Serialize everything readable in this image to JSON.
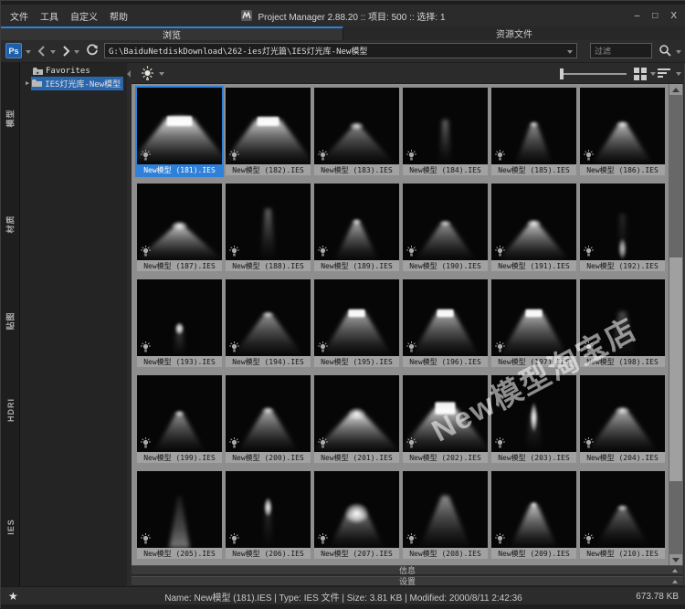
{
  "window": {
    "title": "Project Manager 2.88.20  ::  项目: 500  ::  选择: 1",
    "minimize": "–",
    "maximize": "□",
    "close": "X"
  },
  "menu": {
    "items": [
      "文件",
      "工具",
      "自定义",
      "帮助"
    ]
  },
  "tabs": [
    {
      "label": "浏览",
      "active": true
    },
    {
      "label": "资源文件",
      "active": false
    }
  ],
  "toolbar": {
    "ps_label": "Ps",
    "path": "G:\\BaiduNetdiskDownload\\262-ies灯光篇\\IES灯光库-New模型",
    "filter_placeholder": "过滤"
  },
  "sidebar": {
    "tabs": [
      "模型",
      "材质",
      "贴图",
      "HDRI",
      "IES"
    ],
    "active": "IES"
  },
  "tree": {
    "items": [
      {
        "label": "Favorites",
        "selected": false,
        "expandable": false
      },
      {
        "label": "IES灯光库-New模型",
        "selected": true,
        "expandable": true
      }
    ]
  },
  "watermark": {
    "text": "New模型淘宝店"
  },
  "panels": [
    {
      "label": "信息"
    },
    {
      "label": "设置"
    }
  ],
  "statusbar": {
    "info": "Name: New模型 (181).IES | Type: IES 文件 | Size: 3.81 KB | Modified: 2000/8/11 2:42:36",
    "total": "673.78 KB"
  },
  "grid": {
    "items": [
      {
        "label": "New模型 (181).IES",
        "selected": true,
        "light": {
          "cone": {
            "a": 0.42,
            "tw": 0.17,
            "bw": 0.6,
            "i": 0.85
          },
          "fix": {
            "y": 0.37,
            "h": 0.13,
            "w": 0.15,
            "i": 0.95
          },
          "apex": {
            "i": 0.5,
            "w": 0.45,
            "h": 0.18
          }
        }
      },
      {
        "label": "New模型 (182).IES",
        "light": {
          "cone": {
            "a": 0.42,
            "tw": 0.15,
            "bw": 0.55,
            "i": 0.8
          },
          "fix": {
            "y": 0.38,
            "h": 0.12,
            "w": 0.13,
            "i": 0.95
          }
        }
      },
      {
        "label": "New模型 (183).IES",
        "light": {
          "cone": {
            "a": 0.5,
            "tw": 0.04,
            "bw": 0.46,
            "i": 0.5
          },
          "apex": {
            "i": 0.85,
            "w": 0.18,
            "h": 0.12
          }
        }
      },
      {
        "label": "New模型 (184).IES",
        "light": {
          "cone": {
            "a": 0.42,
            "tw": 0.035,
            "bw": 0.07,
            "i": 0.38
          }
        }
      },
      {
        "label": "New模型 (185).IES",
        "light": {
          "cone": {
            "a": 0.48,
            "tw": 0.035,
            "bw": 0.22,
            "i": 0.55
          },
          "apex": {
            "i": 0.8,
            "w": 0.12,
            "h": 0.1
          }
        }
      },
      {
        "label": "New模型 (186).IES",
        "light": {
          "cone": {
            "a": 0.48,
            "tw": 0.05,
            "bw": 0.36,
            "i": 0.7
          },
          "apex": {
            "i": 0.9,
            "w": 0.16,
            "h": 0.11
          }
        }
      },
      {
        "label": "New模型 (187).IES",
        "light": {
          "cone": {
            "a": 0.55,
            "tw": 0.05,
            "bw": 0.52,
            "i": 0.75
          },
          "apex": {
            "i": 0.95,
            "w": 0.2,
            "h": 0.13
          }
        }
      },
      {
        "label": "New模型 (188).IES",
        "light": {
          "cone": {
            "a": 0.33,
            "tw": 0.035,
            "bw": 0.09,
            "i": 0.38
          }
        }
      },
      {
        "label": "New模型 (189).IES",
        "light": {
          "cone": {
            "a": 0.5,
            "tw": 0.035,
            "bw": 0.26,
            "i": 0.65
          },
          "apex": {
            "i": 0.85,
            "w": 0.12,
            "h": 0.1
          }
        }
      },
      {
        "label": "New模型 (190).IES",
        "light": {
          "cone": {
            "a": 0.52,
            "tw": 0.05,
            "bw": 0.36,
            "i": 0.55
          },
          "apex": {
            "i": 0.8,
            "w": 0.15,
            "h": 0.1
          }
        }
      },
      {
        "label": "New模型 (191).IES",
        "light": {
          "cone": {
            "a": 0.52,
            "tw": 0.05,
            "bw": 0.42,
            "i": 0.75
          },
          "apex": {
            "i": 0.95,
            "w": 0.18,
            "h": 0.12
          }
        }
      },
      {
        "label": "New模型 (192).IES",
        "light": {
          "cone": {
            "a": 0.4,
            "tw": 0.03,
            "bw": 0.06,
            "i": 0.15
          },
          "blob": {
            "y": 0.85,
            "w": 0.1,
            "h": 0.28,
            "i": 0.75
          }
        }
      },
      {
        "label": "New模型 (193).IES",
        "light": {
          "cone": {
            "a": 0.62,
            "tw": 0.03,
            "bw": 0.07,
            "i": 0.28
          },
          "blob": {
            "y": 0.64,
            "w": 0.11,
            "h": 0.17,
            "i": 0.95
          }
        }
      },
      {
        "label": "New模型 (194).IES",
        "light": {
          "cone": {
            "a": 0.46,
            "tw": 0.05,
            "bw": 0.42,
            "i": 0.55
          },
          "apex": {
            "i": 0.8,
            "w": 0.15,
            "h": 0.1
          }
        }
      },
      {
        "label": "New模型 (195).IES",
        "light": {
          "cone": {
            "a": 0.43,
            "tw": 0.1,
            "bw": 0.42,
            "i": 0.65
          },
          "fix": {
            "y": 0.39,
            "h": 0.1,
            "w": 0.1,
            "i": 0.95
          }
        }
      },
      {
        "label": "New模型 (196).IES",
        "light": {
          "cone": {
            "a": 0.43,
            "tw": 0.1,
            "bw": 0.4,
            "i": 0.65
          },
          "fix": {
            "y": 0.39,
            "h": 0.1,
            "w": 0.1,
            "i": 0.95
          }
        }
      },
      {
        "label": "New模型 (197).IES",
        "light": {
          "cone": {
            "a": 0.43,
            "tw": 0.1,
            "bw": 0.4,
            "i": 0.7
          },
          "fix": {
            "y": 0.39,
            "h": 0.1,
            "w": 0.1,
            "i": 0.95
          }
        }
      },
      {
        "label": "New模型 (198).IES",
        "light": {
          "cone": {
            "a": 0.42,
            "tw": 0.04,
            "bw": 0.15,
            "i": 0.28
          }
        }
      },
      {
        "label": "New模型 (199).IES",
        "light": {
          "cone": {
            "a": 0.5,
            "tw": 0.04,
            "bw": 0.3,
            "i": 0.55
          },
          "apex": {
            "i": 0.85,
            "w": 0.13,
            "h": 0.1
          }
        }
      },
      {
        "label": "New模型 (200).IES",
        "light": {
          "cone": {
            "a": 0.46,
            "tw": 0.05,
            "bw": 0.36,
            "i": 0.65
          },
          "apex": {
            "i": 0.85,
            "w": 0.15,
            "h": 0.11
          }
        }
      },
      {
        "label": "New模型 (201).IES",
        "light": {
          "cone": {
            "a": 0.5,
            "tw": 0.08,
            "bw": 0.52,
            "i": 0.85
          },
          "apex": {
            "i": 1,
            "w": 0.22,
            "h": 0.17
          }
        }
      },
      {
        "label": "New模型 (202).IES",
        "light": {
          "cone": {
            "a": 0.43,
            "tw": 0.13,
            "bw": 0.55,
            "i": 0.8
          },
          "fix": {
            "y": 0.35,
            "h": 0.16,
            "w": 0.12,
            "i": 0.95
          }
        }
      },
      {
        "label": "New模型 (203).IES",
        "light": {
          "cone": {
            "a": 0.5,
            "tw": 0.04,
            "bw": 0.1,
            "i": 0.22
          },
          "blob": {
            "y": 0.55,
            "w": 0.09,
            "h": 0.4,
            "i": 1
          }
        }
      },
      {
        "label": "New模型 (204).IES",
        "light": {
          "cone": {
            "a": 0.46,
            "tw": 0.06,
            "bw": 0.42,
            "i": 0.65
          },
          "apex": {
            "i": 0.9,
            "w": 0.18,
            "h": 0.12
          }
        }
      },
      {
        "label": "New模型 (205).IES",
        "light": {
          "cone": {
            "a": 0.33,
            "tw": 0.02,
            "bw": 0.12,
            "i": 0.45,
            "up": true
          }
        }
      },
      {
        "label": "New模型 (206).IES",
        "light": {
          "cone": {
            "a": 0.45,
            "tw": 0.03,
            "bw": 0.06,
            "i": 0.18
          },
          "blob": {
            "y": 0.47,
            "w": 0.1,
            "h": 0.26,
            "i": 0.95
          }
        }
      },
      {
        "label": "New模型 (207).IES",
        "light": {
          "cone": {
            "a": 0.55,
            "tw": 0.12,
            "bw": 0.32,
            "i": 0.45
          },
          "blob": {
            "y": 0.55,
            "w": 0.3,
            "h": 0.28,
            "i": 1
          }
        }
      },
      {
        "label": "New模型 (208).IES",
        "light": {
          "cone": {
            "a": 0.32,
            "tw": 0.04,
            "bw": 0.3,
            "i": 0.55
          }
        }
      },
      {
        "label": "New模型 (209).IES",
        "light": {
          "cone": {
            "a": 0.44,
            "tw": 0.04,
            "bw": 0.28,
            "i": 0.75
          },
          "apex": {
            "i": 0.9,
            "w": 0.1,
            "h": 0.1
          }
        }
      },
      {
        "label": "New模型 (210).IES",
        "light": {
          "cone": {
            "a": 0.48,
            "tw": 0.04,
            "bw": 0.3,
            "i": 0.42,
            "end": 0.95
          },
          "apex": {
            "i": 0.75,
            "w": 0.14,
            "h": 0.1
          }
        }
      }
    ]
  }
}
